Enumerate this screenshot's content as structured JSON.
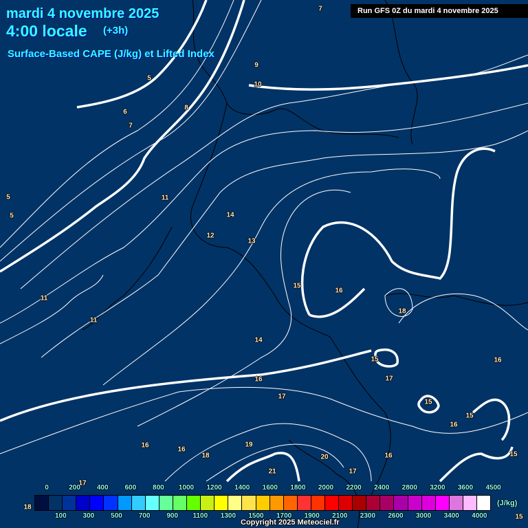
{
  "header": {
    "date": "mardi 4 novembre 2025",
    "time": "4:00 locale",
    "lead": "(+3h)",
    "parameter": "Surface-Based CAPE (J/kg) et Lifted Index",
    "run": "Run GFS 0Z du mardi 4 novembre 2025"
  },
  "map": {
    "background_color": "#023366",
    "contour_labels": [
      "7",
      "9",
      "10",
      "5",
      "6",
      "7",
      "8",
      "5",
      "5",
      "11",
      "14",
      "12",
      "13",
      "11",
      "11",
      "15",
      "16",
      "18",
      "14",
      "15",
      "16",
      "16",
      "17",
      "17",
      "15",
      "15",
      "16",
      "16",
      "16",
      "18",
      "19",
      "20",
      "16",
      "15",
      "17",
      "21",
      "17",
      "18",
      "17",
      "15"
    ]
  },
  "colorbar": {
    "labels": [
      "0",
      "100",
      "200",
      "300",
      "400",
      "500",
      "600",
      "700",
      "800",
      "900",
      "1000",
      "1100",
      "1200",
      "1300",
      "1400",
      "1500",
      "1600",
      "1700",
      "1800",
      "1900",
      "2000",
      "2100",
      "2200",
      "2300",
      "2400",
      "2600",
      "2800",
      "3000",
      "3200",
      "3400",
      "3600",
      "4000",
      "4500"
    ],
    "colors": [
      "#000f40",
      "#023366",
      "#003399",
      "#0000cc",
      "#0000ff",
      "#0033ff",
      "#0099ff",
      "#33ccff",
      "#66ffff",
      "#66ff99",
      "#66ff66",
      "#66ff00",
      "#c8f014",
      "#ffff00",
      "#ffff88",
      "#ffe34d",
      "#ffcc00",
      "#ff9900",
      "#ff6600",
      "#ff3333",
      "#ff3300",
      "#ff0000",
      "#dd0000",
      "#aa0000",
      "#aa0033",
      "#aa0066",
      "#aa00aa",
      "#cc00cc",
      "#dd00dd",
      "#ff00ff",
      "#dd77dd",
      "#ffbbff",
      "#ffffff"
    ],
    "unit": "(J/kg)"
  },
  "footer": {
    "copyright": "Copyright 2025 Meteociel.fr"
  }
}
